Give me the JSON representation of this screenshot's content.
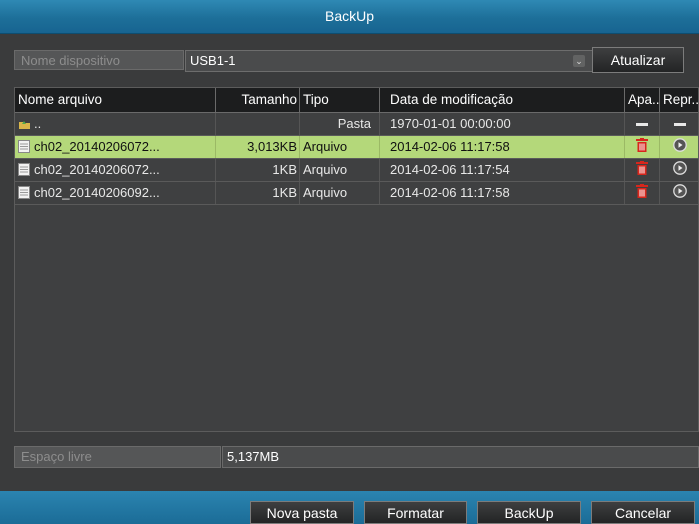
{
  "window": {
    "title": "BackUp"
  },
  "device": {
    "label": "Nome dispositivo",
    "selected": "USB1-1",
    "refresh_label": "Atualizar"
  },
  "table": {
    "headers": {
      "name": "Nome arquivo",
      "size": "Tamanho",
      "type": "Tipo",
      "modified": "Data de modificação",
      "delete": "Apa...",
      "play": "Repr..."
    },
    "rows": [
      {
        "name": "..",
        "size": "",
        "type": "Pasta",
        "modified": "1970-01-01 00:00:00",
        "icon": "folder-up-icon"
      },
      {
        "name": "ch02_20140206072...",
        "size": "3,013KB",
        "type": "Arquivo",
        "modified": "2014-02-06 11:17:58",
        "icon": "file-icon",
        "selected": true
      },
      {
        "name": "ch02_20140206072...",
        "size": "1KB",
        "type": "Arquivo",
        "modified": "2014-02-06 11:17:54",
        "icon": "file-icon"
      },
      {
        "name": "ch02_20140206092...",
        "size": "1KB",
        "type": "Arquivo",
        "modified": "2014-02-06 11:17:58",
        "icon": "file-icon"
      }
    ]
  },
  "free_space": {
    "label": "Espaço livre",
    "value": "5,137MB"
  },
  "buttons": {
    "new_folder": "Nova pasta",
    "format": "Formatar",
    "backup": "BackUp",
    "cancel": "Cancelar"
  },
  "colors": {
    "title_bar": "#1d6f99",
    "selected_row": "#b4d87a",
    "delete_icon": "#d7261c"
  }
}
